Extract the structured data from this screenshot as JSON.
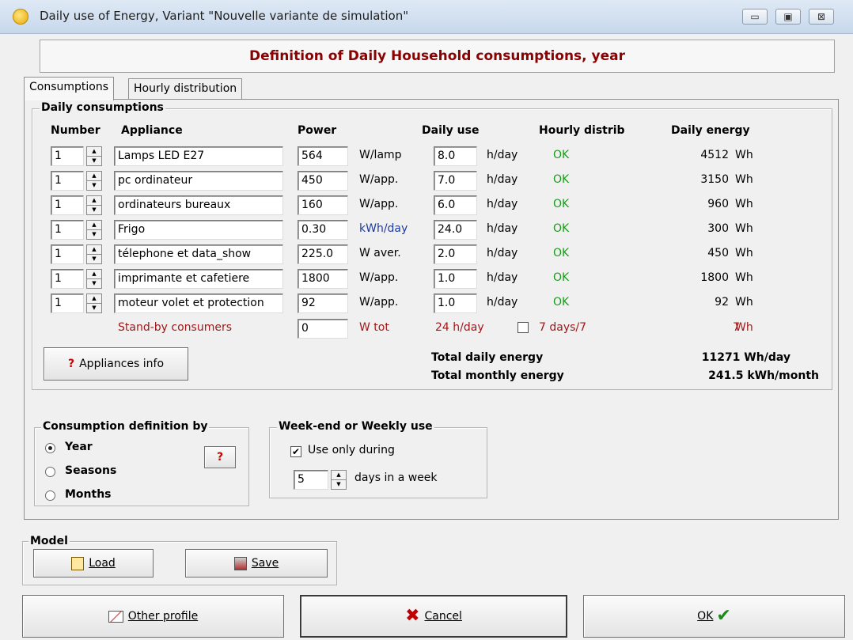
{
  "window": {
    "title": "Daily use of Energy, Variant  \"Nouvelle variante de simulation\"",
    "minimize_glyph": "▭",
    "maximize_glyph": "▣",
    "close_glyph": "⊠"
  },
  "header": {
    "title": "Definition of Daily Household consumptions, year"
  },
  "tabs": [
    {
      "label": "Consumptions"
    },
    {
      "label": "Hourly distribution"
    }
  ],
  "daily": {
    "group_title": "Daily consumptions",
    "columns": {
      "number": "Number",
      "appliance": "Appliance",
      "power": "Power",
      "daily_use": "Daily use",
      "hourly": "Hourly distrib",
      "energy": "Daily energy"
    },
    "rows": [
      {
        "number": "1",
        "appliance": "Lamps LED E27",
        "power": "564",
        "unit": "W/lamp",
        "use": "8.0",
        "use_unit": "h/day",
        "hourly": "OK",
        "energy": "4512",
        "energy_unit": "Wh"
      },
      {
        "number": "1",
        "appliance": "pc ordinateur",
        "power": "450",
        "unit": "W/app.",
        "use": "7.0",
        "use_unit": "h/day",
        "hourly": "OK",
        "energy": "3150",
        "energy_unit": "Wh"
      },
      {
        "number": "1",
        "appliance": "ordinateurs bureaux",
        "power": "160",
        "unit": "W/app.",
        "use": "6.0",
        "use_unit": "h/day",
        "hourly": "OK",
        "energy": "960",
        "energy_unit": "Wh"
      },
      {
        "number": "1",
        "appliance": "Frigo",
        "power": "0.30",
        "unit": "kWh/day",
        "use": "24.0",
        "use_unit": "h/day",
        "hourly": "OK",
        "energy": "300",
        "energy_unit": "Wh"
      },
      {
        "number": "1",
        "appliance": "télephone et data_show",
        "power": "225.0",
        "unit": "W aver.",
        "use": "2.0",
        "use_unit": "h/day",
        "hourly": "OK",
        "energy": "450",
        "energy_unit": "Wh"
      },
      {
        "number": "1",
        "appliance": "imprimante et cafetiere",
        "power": "1800",
        "unit": "W/app.",
        "use": "1.0",
        "use_unit": "h/day",
        "hourly": "OK",
        "energy": "1800",
        "energy_unit": "Wh"
      },
      {
        "number": "1",
        "appliance": "moteur volet et protection",
        "power": "92",
        "unit": "W/app.",
        "use": "1.0",
        "use_unit": "h/day",
        "hourly": "OK",
        "energy": "92",
        "energy_unit": "Wh"
      }
    ],
    "standby": {
      "label": "Stand-by consumers",
      "power": "0",
      "unit": "W tot",
      "hours": "24 h/day",
      "days_label": "7 days/7",
      "days_checked": false,
      "energy": "7",
      "energy_unit": "Wh"
    },
    "appliances_info_button": "Appliances info",
    "total_daily_label": "Total daily energy",
    "total_daily_value": "11271 Wh/day",
    "total_monthly_label": "Total monthly energy",
    "total_monthly_value": "241.5 kWh/month"
  },
  "definition": {
    "group_title": "Consumption definition by",
    "options": [
      {
        "label": "Year",
        "selected": true
      },
      {
        "label": "Seasons",
        "selected": false
      },
      {
        "label": "Months",
        "selected": false
      }
    ],
    "help_glyph": "?"
  },
  "weekly": {
    "group_title": "Week-end or Weekly use",
    "use_only_label": "Use only during",
    "use_only_checked": true,
    "days_value": "5",
    "days_label": "days in a week"
  },
  "model": {
    "group_title": "Model",
    "load_label": "Load",
    "save_label": "Save"
  },
  "footer": {
    "other_profile_label": "Other profile",
    "cancel_label": "Cancel",
    "ok_label": "OK"
  },
  "colors": {
    "header_text": "#8b0000",
    "ok_green": "#1a9a1a",
    "unit_blue": "#1e3c9e",
    "standby_red": "#a01818"
  }
}
